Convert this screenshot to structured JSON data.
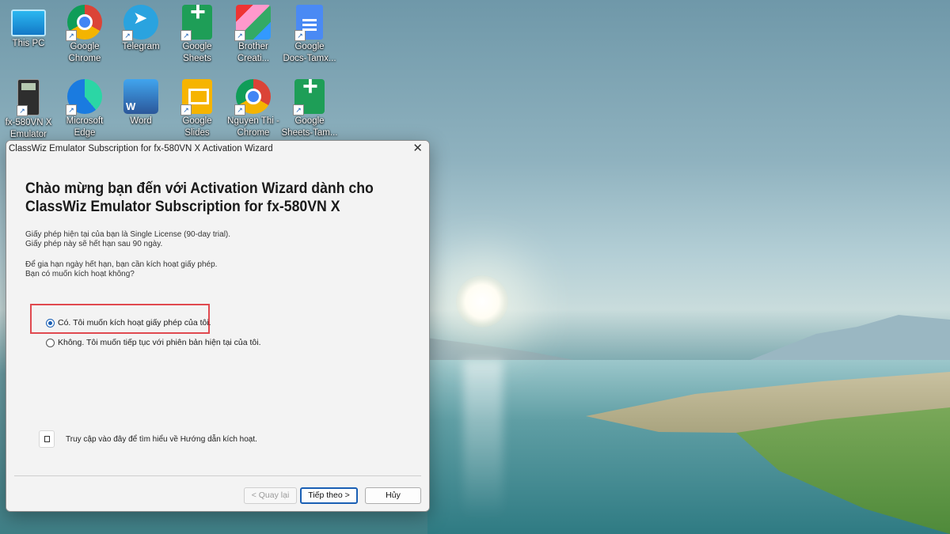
{
  "desktop": {
    "icons": [
      {
        "label": "This PC",
        "icon": "computer-icon"
      },
      {
        "label": "Google\nChrome",
        "icon": "chrome-icon"
      },
      {
        "label": "Telegram",
        "icon": "telegram-icon"
      },
      {
        "label": "Google\nSheets",
        "icon": "google-sheets-icon"
      },
      {
        "label": "Brother\nCreati...",
        "icon": "brother-icon"
      },
      {
        "label": "Google\nDocs-Tamx...",
        "icon": "google-docs-icon"
      },
      {
        "label": "fx-580VN X\nEmulator",
        "icon": "calculator-icon"
      },
      {
        "label": "Microsoft\nEdge",
        "icon": "edge-icon"
      },
      {
        "label": "Word",
        "icon": "word-icon"
      },
      {
        "label": "Google\nSlides",
        "icon": "google-slides-icon"
      },
      {
        "label": "Nguyen Thi -\nChrome",
        "icon": "chrome-profile-icon"
      },
      {
        "label": "Google\nSheets-Tam...",
        "icon": "google-sheets-icon"
      }
    ]
  },
  "dialog": {
    "title": "ClassWiz Emulator Subscription for fx-580VN X Activation Wizard",
    "heading": "Chào mừng bạn đến với Activation Wizard dành cho ClassWiz Emulator Subscription for fx-580VN X",
    "para1_line1": "Giấy phép hiện tại của bạn là Single License (90-day trial).",
    "para1_line2": "Giấy phép này sẽ hết hạn sau 90 ngày.",
    "para2_line1": "Để gia hạn ngày hết hạn, bạn cần kích hoạt giấy phép.",
    "para2_line2": "Bạn có muốn kích hoạt không?",
    "option_yes": "Có. Tôi muốn kích hoạt giấy phép của tôi.",
    "option_no": "Không. Tôi muốn tiếp tục với phiên bản hiện tại của tôi.",
    "selected_option": "yes",
    "help_link": "Truy cập vào đây để tìm hiểu về Hướng dẫn kích hoạt.",
    "buttons": {
      "back": "< Quay lại",
      "next": "Tiếp theo >",
      "cancel": "Hủy"
    },
    "close_symbol": "✕"
  },
  "colors": {
    "highlight_border": "#e0494f",
    "accent": "#1a5fb4"
  }
}
